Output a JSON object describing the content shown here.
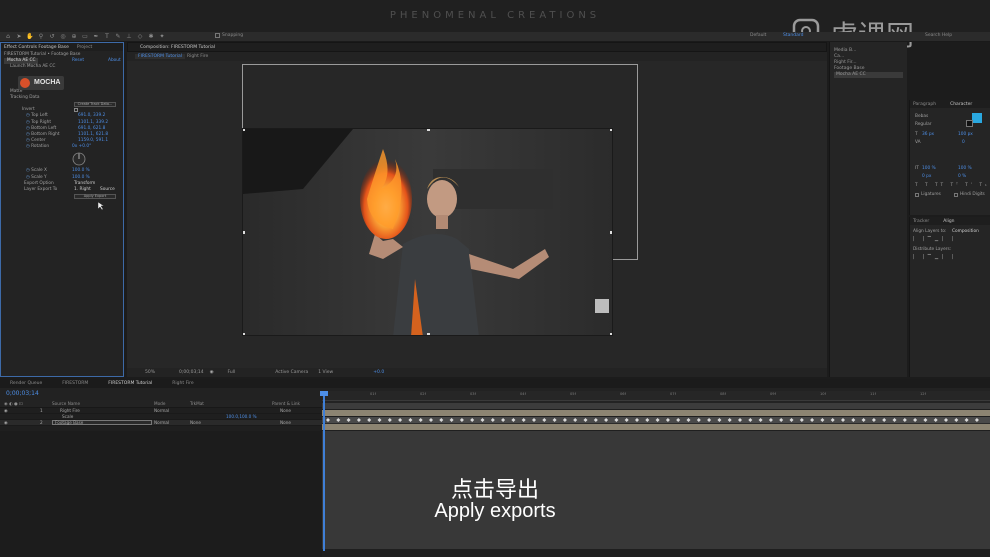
{
  "banner": {
    "title": "PHENOMENAL CREATIONS"
  },
  "toolbar": {
    "snapping_label": "Snapping",
    "workspace_default": "Default",
    "workspace_standard": "Standard",
    "search_label": "Search Help"
  },
  "watermark": {
    "text": "虎课网"
  },
  "effect_controls": {
    "tabs": [
      "Effect Controls Footage Base",
      "Project"
    ],
    "header": "FIRESTORM Tutorial • Footage Base",
    "effect_name": "Mocha AE CC",
    "effect_reset": "Reset",
    "effect_about": "About",
    "launch_label": "Launch Mocha AE CC",
    "logo_text": "MOCHA",
    "matte_label": "Matte",
    "tracking_label": "Tracking Data",
    "create_track_btn": "Create Track Data...",
    "invert_label": "Invert",
    "points": [
      {
        "label": "Top Left",
        "value": "691.0, 339.2"
      },
      {
        "label": "Top Right",
        "value": "1101.1, 339.2"
      },
      {
        "label": "Bottom Left",
        "value": "691.0, 621.8"
      },
      {
        "label": "Bottom Right",
        "value": "1101.1, 621.8"
      },
      {
        "label": "Center",
        "value": "1159.0, 591.1"
      }
    ],
    "rotation_label": "Rotation",
    "rotation_value": "0x +0.0°",
    "scale_x_label": "Scale X",
    "scale_x_value": "100.0 %",
    "scale_y_label": "Scale Y",
    "scale_y_value": "100.0 %",
    "export_option_label": "Export Option",
    "export_option_value": "Transform",
    "layer_export_label": "Layer Export To",
    "layer_export_value": "1. Right",
    "layer_export_source": "Source",
    "apply_export_btn": "Apply Export"
  },
  "composition": {
    "tab_label": "Composition: FIRESTORM Tutorial",
    "breadcrumb_comp": "FIRESTORM Tutorial",
    "breadcrumb_layer": "Right Fire"
  },
  "viewer_bar": {
    "zoom": "50%",
    "timecode": "0;00;03;14",
    "resolution": "Full",
    "camera": "Active Camera",
    "views": "1 View",
    "exposure": "+0.0"
  },
  "info_panel": {
    "lines": [
      "Media B...",
      "Ca...",
      "Right Fir...",
      "Footage Base",
      "Mocha AE CC"
    ]
  },
  "character_panel": {
    "tabs": [
      "Paragraph",
      "Character"
    ],
    "font": "Bebas",
    "style": "Regular",
    "size": "36 px",
    "leading": "100 px",
    "tracking": "0",
    "vert_scale": "100 %",
    "horiz_scale": "100 %",
    "baseline": "0 px",
    "tsume": "0 %",
    "ligatures_label": "Ligatures",
    "hindi_label": "Hindi Digits"
  },
  "align_panel": {
    "tabs": [
      "Tracker",
      "Align"
    ],
    "align_to_label": "Align Layers to:",
    "align_to_value": "Composition",
    "distribute_label": "Distribute Layers:"
  },
  "timeline": {
    "tabs": [
      "Render Queue",
      "FIRESTORM",
      "FIRESTORM Tutorial",
      "Right Fire"
    ],
    "timecode": "0;00;03;14",
    "columns": {
      "source_name": "Source Name",
      "mode": "Mode",
      "trkmat": "TrkMat",
      "parent": "Parent & Link"
    },
    "layers": [
      {
        "num": "1",
        "name": "Right Fire",
        "mode": "Normal",
        "trkmat": "",
        "parent": "None"
      },
      {
        "num": "",
        "name": "Scale",
        "mode": "",
        "trkmat": "",
        "parent": "",
        "value": "100.0,100.0 %"
      },
      {
        "num": "2",
        "name": "Footage Base",
        "mode": "Normal",
        "trkmat": "None",
        "parent": "None"
      }
    ],
    "ruler_ticks": [
      "0s",
      "01f",
      "02f",
      "03f",
      "04f",
      "05f",
      "06f",
      "07f",
      "08f",
      "09f",
      "10f",
      "11f",
      "12f"
    ]
  },
  "subtitles": {
    "chinese": "点击导出",
    "english": "Apply exports"
  },
  "colors": {
    "accent_blue": "#4d8ee6",
    "mocha_orange": "#d8502a",
    "fill_cyan": "#2aa8e0",
    "timeline_tan": "#8c8472"
  }
}
